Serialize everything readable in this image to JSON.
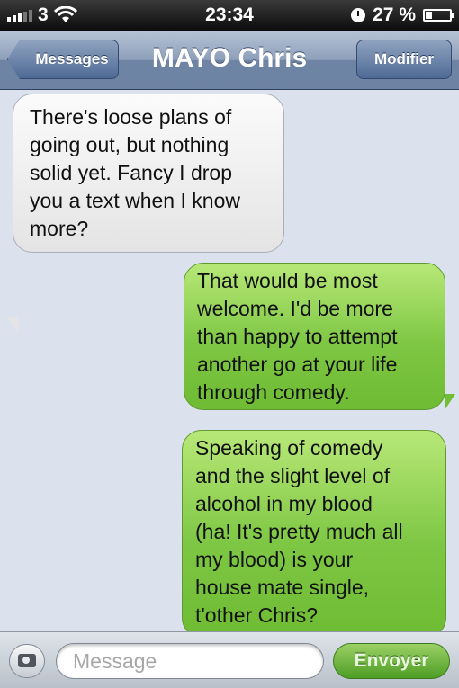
{
  "status_bar": {
    "carrier": "3",
    "time": "23:34",
    "battery_percent": "27 %",
    "battery_level": 0.27
  },
  "nav": {
    "back_label": "Messages",
    "title": "MAYO Chris",
    "edit_label": "Modifier"
  },
  "messages": [
    {
      "direction": "incoming",
      "text": "There's loose plans of\ngoing out, but nothing\nsolid yet. Fancy I drop\nyou a text when I know\nmore?"
    },
    {
      "direction": "outgoing",
      "text": "That would be most\nwelcome.  I'd be more\nthan happy to attempt\nanother go at your life\nthrough comedy."
    },
    {
      "direction": "outgoing",
      "text": "Speaking of comedy\nand the slight level of\nalcohol in my blood\n(ha! It's pretty much all\nmy blood) is your\nhouse mate single,\nt'other Chris?"
    }
  ],
  "composer": {
    "placeholder": "Message",
    "send_label": "Envoyer"
  },
  "colors": {
    "outgoing_bubble": "#7ec744",
    "incoming_bubble": "#eeeeee",
    "nav_bar": "#8d9fb9",
    "background": "#dbe2ed"
  }
}
